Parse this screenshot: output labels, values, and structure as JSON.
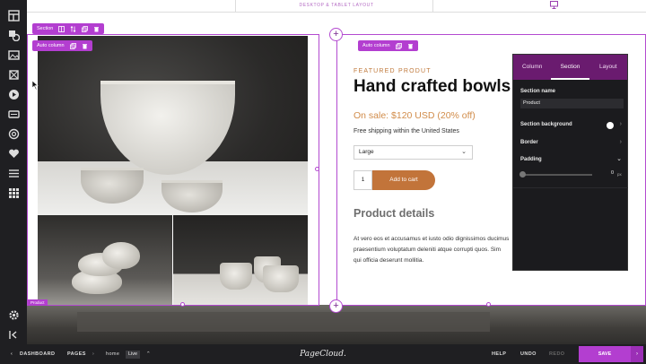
{
  "topbar": {
    "layout_label": "DESKTOP & TABLET LAYOUT"
  },
  "section_toolbar": {
    "label": "Section"
  },
  "left_column_toolbar": {
    "label": "Auto column"
  },
  "right_column_toolbar": {
    "label": "Auto column"
  },
  "product_label": "Product",
  "product": {
    "eyebrow": "FEATURED PRODUT",
    "title": "Hand crafted bowls",
    "price": "On sale: $120 USD (20% off)",
    "shipping": "Free shipping within the United States",
    "size_select": "Large",
    "quantity": "1",
    "add_to_cart": "Add to cart",
    "details_heading": "Product details",
    "details_lines": [
      "At vero eos et accusamus et iusto odio dignissimos ducimus",
      "praesentium voluptatum deleniti atque corrupti quos. Sim",
      "qui officia deserunt mollitia."
    ]
  },
  "panel": {
    "tabs": [
      "Column",
      "Section",
      "Layout"
    ],
    "active_tab": "Section",
    "section_name_label": "Section name",
    "section_name_value": "Product",
    "background_label": "Section background",
    "border_label": "Border",
    "padding_label": "Padding",
    "padding_value": "0",
    "padding_unit": "px"
  },
  "bottombar": {
    "dashboard": "DASHBOARD",
    "pages": "PAGES",
    "page_name": "home",
    "status": "Live",
    "logo": "PageCloud.",
    "help": "HELP",
    "undo": "UNDO",
    "redo": "REDO",
    "save": "SAVE"
  },
  "colors": {
    "accent": "#b33ed0",
    "panel_header": "#6a1b6f",
    "cta": "#c2743a",
    "price": "#d18c4a"
  }
}
